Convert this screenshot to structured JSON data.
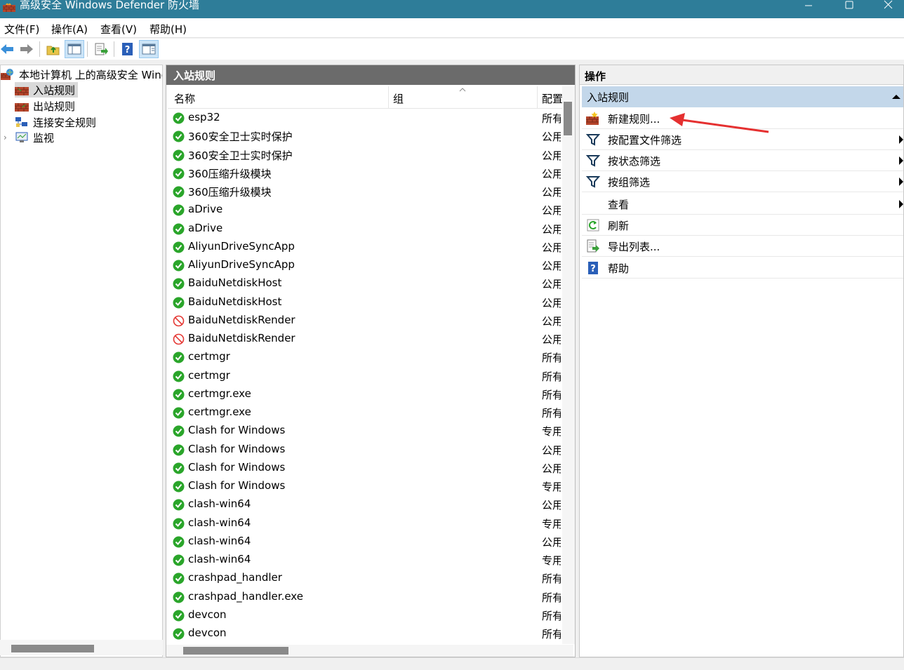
{
  "window": {
    "title": "高级安全 Windows Defender 防火墙"
  },
  "menu": [
    "文件(F)",
    "操作(A)",
    "查看(V)",
    "帮助(H)"
  ],
  "tree": {
    "root": "本地计算机 上的高级安全 Windc",
    "items": [
      "入站规则",
      "出站规则",
      "连接安全规则",
      "监视"
    ]
  },
  "center": {
    "header": "入站规则",
    "columns": {
      "name": "名称",
      "group": "组",
      "profile": "配置"
    },
    "rows": [
      {
        "name": "esp32",
        "status": "allow",
        "profile": "所有"
      },
      {
        "name": "360安全卫士实时保护",
        "status": "allow",
        "profile": "公用"
      },
      {
        "name": "360安全卫士实时保护",
        "status": "allow",
        "profile": "公用"
      },
      {
        "name": "360压缩升级模块",
        "status": "allow",
        "profile": "公用"
      },
      {
        "name": "360压缩升级模块",
        "status": "allow",
        "profile": "公用"
      },
      {
        "name": "aDrive",
        "status": "allow",
        "profile": "公用"
      },
      {
        "name": "aDrive",
        "status": "allow",
        "profile": "公用"
      },
      {
        "name": "AliyunDriveSyncApp",
        "status": "allow",
        "profile": "公用"
      },
      {
        "name": "AliyunDriveSyncApp",
        "status": "allow",
        "profile": "公用"
      },
      {
        "name": "BaiduNetdiskHost",
        "status": "allow",
        "profile": "公用"
      },
      {
        "name": "BaiduNetdiskHost",
        "status": "allow",
        "profile": "公用"
      },
      {
        "name": "BaiduNetdiskRender",
        "status": "block",
        "profile": "公用"
      },
      {
        "name": "BaiduNetdiskRender",
        "status": "block",
        "profile": "公用"
      },
      {
        "name": "certmgr",
        "status": "allow",
        "profile": "所有"
      },
      {
        "name": "certmgr",
        "status": "allow",
        "profile": "所有"
      },
      {
        "name": "certmgr.exe",
        "status": "allow",
        "profile": "所有"
      },
      {
        "name": "certmgr.exe",
        "status": "allow",
        "profile": "所有"
      },
      {
        "name": "Clash for Windows",
        "status": "allow",
        "profile": "专用"
      },
      {
        "name": "Clash for Windows",
        "status": "allow",
        "profile": "公用"
      },
      {
        "name": "Clash for Windows",
        "status": "allow",
        "profile": "公用"
      },
      {
        "name": "Clash for Windows",
        "status": "allow",
        "profile": "专用"
      },
      {
        "name": "clash-win64",
        "status": "allow",
        "profile": "公用"
      },
      {
        "name": "clash-win64",
        "status": "allow",
        "profile": "专用"
      },
      {
        "name": "clash-win64",
        "status": "allow",
        "profile": "公用"
      },
      {
        "name": "clash-win64",
        "status": "allow",
        "profile": "专用"
      },
      {
        "name": "crashpad_handler",
        "status": "allow",
        "profile": "所有"
      },
      {
        "name": "crashpad_handler.exe",
        "status": "allow",
        "profile": "所有"
      },
      {
        "name": "devcon",
        "status": "allow",
        "profile": "所有"
      },
      {
        "name": "devcon",
        "status": "allow",
        "profile": "所有"
      }
    ]
  },
  "actions": {
    "header": "操作",
    "section": "入站规则",
    "items": [
      {
        "label": "新建规则...",
        "icon": "new-rule-icon",
        "submenu": false
      },
      {
        "label": "按配置文件筛选",
        "icon": "filter-icon",
        "submenu": true
      },
      {
        "label": "按状态筛选",
        "icon": "filter-icon",
        "submenu": true
      },
      {
        "label": "按组筛选",
        "icon": "filter-icon",
        "submenu": true
      },
      {
        "label": "查看",
        "icon": "",
        "submenu": true
      },
      {
        "label": "刷新",
        "icon": "refresh-icon",
        "submenu": false
      },
      {
        "label": "导出列表...",
        "icon": "export-icon",
        "submenu": false
      },
      {
        "label": "帮助",
        "icon": "help-icon",
        "submenu": false
      }
    ]
  },
  "colors": {
    "titlebar": "#2e7d99",
    "allow": "#2aa52a",
    "block": "#e53935",
    "selection": "#c3d7ea",
    "annotation": "#e53030"
  }
}
